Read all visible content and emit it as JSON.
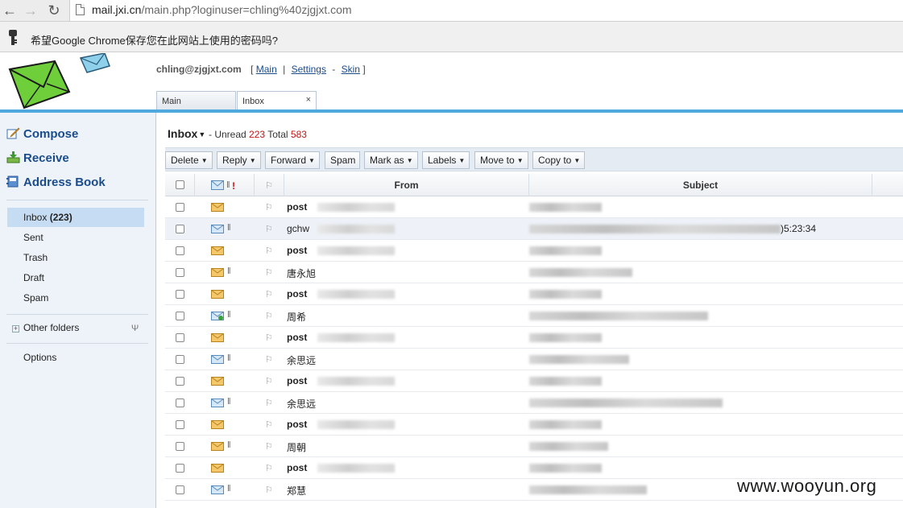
{
  "browser": {
    "url_host": "mail.jxi.cn",
    "url_rest": "/main.php?loginuser=chling%40zjgjxt.com",
    "password_prompt": "希望Google Chrome保存您在此网站上使用的密码吗?"
  },
  "header": {
    "user_email": "chling@zjgjxt.com",
    "bracket_open": "[",
    "bracket_close": "]",
    "links": {
      "main": "Main",
      "settings": "Settings",
      "skin": "Skin"
    },
    "sep1": "|",
    "sep2": "-",
    "tabs": {
      "main": "Main",
      "inbox": "Inbox",
      "close": "×"
    }
  },
  "sidebar": {
    "actions": {
      "compose": "Compose",
      "receive": "Receive",
      "address_book": "Address Book"
    },
    "folders": {
      "inbox_label": "Inbox",
      "inbox_count": "(223)",
      "sent": "Sent",
      "trash": "Trash",
      "draft": "Draft",
      "spam": "Spam"
    },
    "other_folders": "Other folders",
    "options": "Options"
  },
  "inbox": {
    "title": "Inbox",
    "unread_label": "- Unread",
    "unread": "223",
    "total_label": "Total",
    "total": "583"
  },
  "toolbar": {
    "delete": "Delete",
    "reply": "Reply",
    "forward": "Forward",
    "spam": "Spam",
    "mark_as": "Mark as",
    "labels": "Labels",
    "move_to": "Move to",
    "copy_to": "Copy to"
  },
  "columns": {
    "from": "From",
    "subject": "Subject"
  },
  "rows": [
    {
      "from": "post",
      "bold": true,
      "icon": "envelope-closed-icon",
      "attach": false,
      "subj_w": 90
    },
    {
      "from": "gchw",
      "bold": false,
      "icon": "envelope-open-icon",
      "attach": true,
      "subj_w": 312,
      "time": ")5:23:34"
    },
    {
      "from": "post",
      "bold": true,
      "icon": "envelope-closed-icon",
      "attach": false,
      "subj_w": 90
    },
    {
      "from": "唐永旭",
      "bold": false,
      "icon": "envelope-closed-icon",
      "attach": true,
      "subj_w": 128
    },
    {
      "from": "post",
      "bold": true,
      "icon": "envelope-closed-icon",
      "attach": false,
      "subj_w": 90
    },
    {
      "from": "周希",
      "bold": false,
      "icon": "envelope-replied-icon",
      "attach": true,
      "subj_w": 222
    },
    {
      "from": "post",
      "bold": true,
      "icon": "envelope-closed-icon",
      "attach": false,
      "subj_w": 90
    },
    {
      "from": "余思远",
      "bold": false,
      "icon": "envelope-open-icon",
      "attach": true,
      "subj_w": 124
    },
    {
      "from": "post",
      "bold": true,
      "icon": "envelope-closed-icon",
      "attach": false,
      "subj_w": 90
    },
    {
      "from": "余思远",
      "bold": false,
      "icon": "envelope-open-icon",
      "attach": true,
      "subj_w": 240
    },
    {
      "from": "post",
      "bold": true,
      "icon": "envelope-closed-icon",
      "attach": false,
      "subj_w": 90
    },
    {
      "from": "周朝",
      "bold": false,
      "icon": "envelope-closed-icon",
      "attach": true,
      "subj_w": 98
    },
    {
      "from": "post",
      "bold": true,
      "icon": "envelope-closed-icon",
      "attach": false,
      "subj_w": 90
    },
    {
      "from": "郑慧",
      "bold": false,
      "icon": "envelope-open-icon",
      "attach": true,
      "subj_w": 146
    }
  ],
  "watermark": "www.wooyun.org"
}
